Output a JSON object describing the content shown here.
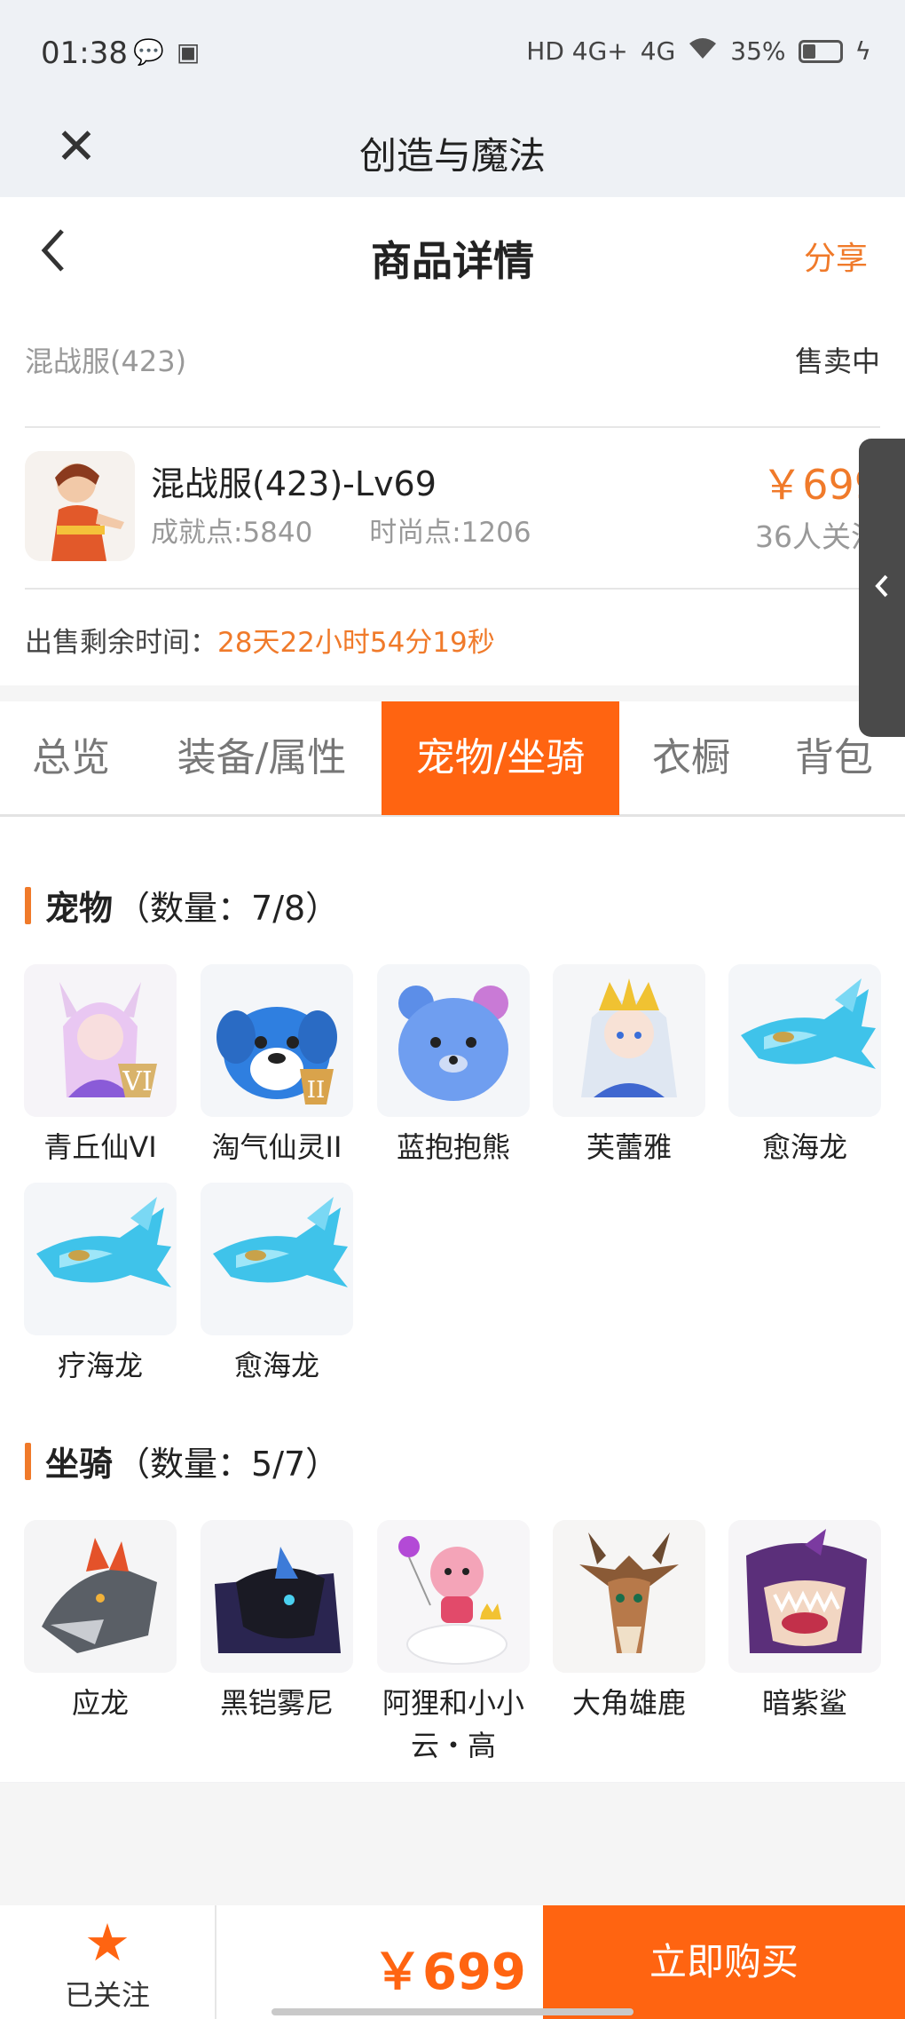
{
  "status_bar": {
    "time": "01:38",
    "network_1": "HD 4G+",
    "network_2": "4G",
    "battery": "35%",
    "battery_level": 0.35
  },
  "app_bar": {
    "close_icon": "close-icon",
    "title": "创造与魔法"
  },
  "nav": {
    "back_icon": "chevron-left-icon",
    "title": "商品详情",
    "share": "分享"
  },
  "listing": {
    "server": "混战服(423)",
    "status": "售卖中",
    "title": "混战服(423)-Lv69",
    "achievement": "成就点:5840",
    "fashion": "时尚点:1206",
    "price": "￥699",
    "watchers": "36人关注",
    "time_left_label": "出售剩余时间：",
    "time_left_value": "28天22小时54分19秒"
  },
  "tabs": [
    {
      "label": "总览"
    },
    {
      "label": "装备/属性"
    },
    {
      "label": "宠物/坐骑"
    },
    {
      "label": "衣橱"
    },
    {
      "label": "背包"
    }
  ],
  "pets": {
    "title": "宠物",
    "count": "（数量：7/8）",
    "items": [
      {
        "label": "青丘仙VI"
      },
      {
        "label": "淘气仙灵II"
      },
      {
        "label": "蓝抱抱熊"
      },
      {
        "label": "芙蕾雅"
      },
      {
        "label": "愈海龙"
      },
      {
        "label": "疗海龙"
      },
      {
        "label": "愈海龙"
      }
    ]
  },
  "mounts": {
    "title": "坐骑",
    "count": "（数量：5/7）",
    "items": [
      {
        "label": "应龙"
      },
      {
        "label": "黑铠雾尼"
      },
      {
        "label": "阿狸和小小云・高"
      },
      {
        "label": "大角雄鹿"
      },
      {
        "label": "暗紫鲨"
      }
    ]
  },
  "bottom": {
    "follow": "已关注",
    "price": "￥699",
    "buy": "立即购买"
  },
  "colors": {
    "accent": "#ff6411",
    "orange_text": "#f07a2a"
  }
}
